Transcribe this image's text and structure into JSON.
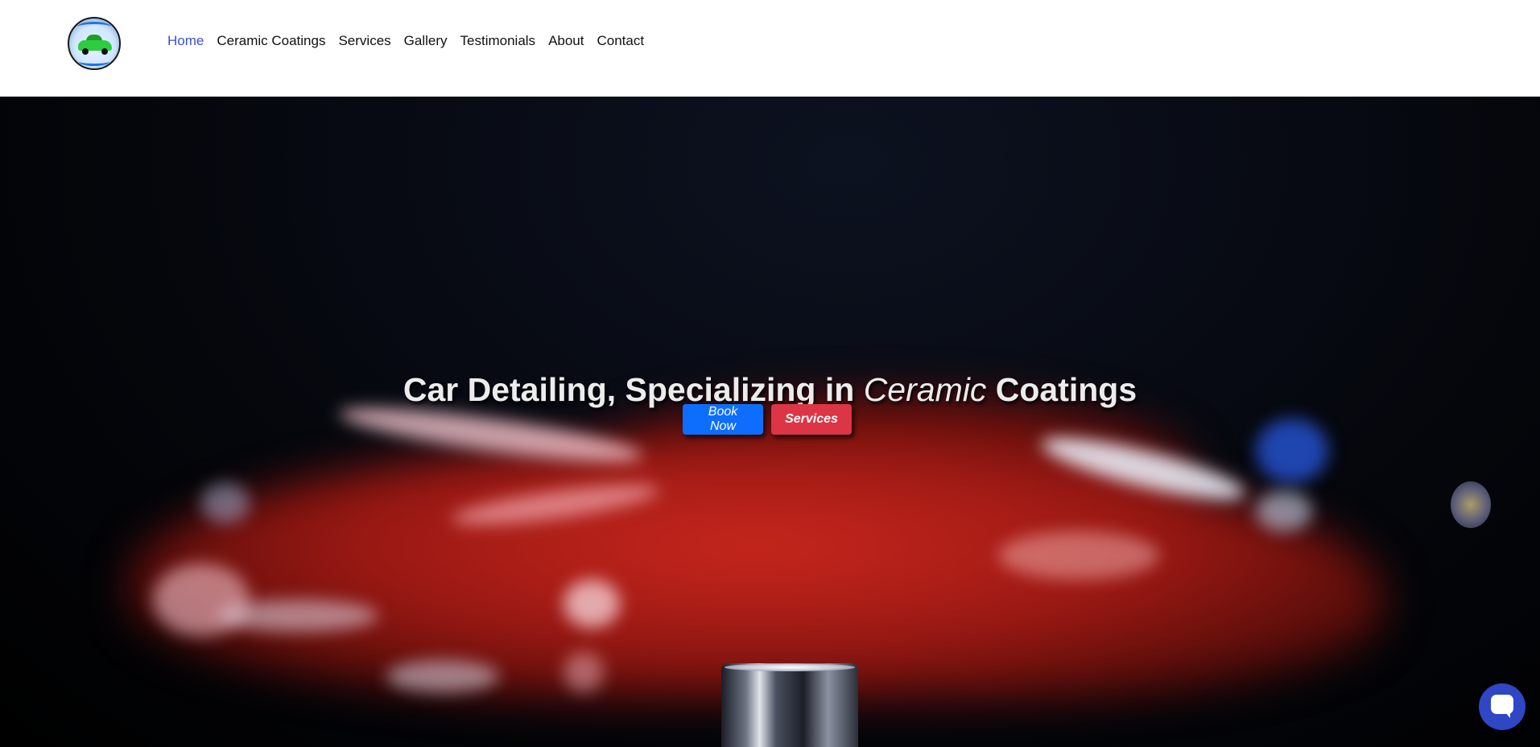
{
  "header": {
    "logo_icon": "car-logo-icon",
    "nav": [
      {
        "label": "Home",
        "active": true
      },
      {
        "label": "Ceramic Coatings",
        "active": false
      },
      {
        "label": "Services",
        "active": false
      },
      {
        "label": "Gallery",
        "active": false
      },
      {
        "label": "Testimonials",
        "active": false
      },
      {
        "label": "About",
        "active": false
      },
      {
        "label": "Contact",
        "active": false
      }
    ],
    "active_color": "#3b4fd6"
  },
  "hero": {
    "headline_before": "Car Detailing, Specializing in ",
    "headline_emphasis": "Ceramic",
    "headline_after": " Coatings",
    "book_label": "Book Now",
    "services_label": "Services",
    "book_color": "#0d6efd",
    "services_color": "#dc3545"
  },
  "chat": {
    "icon": "chat-bubble-icon",
    "color": "#2f46c5"
  }
}
